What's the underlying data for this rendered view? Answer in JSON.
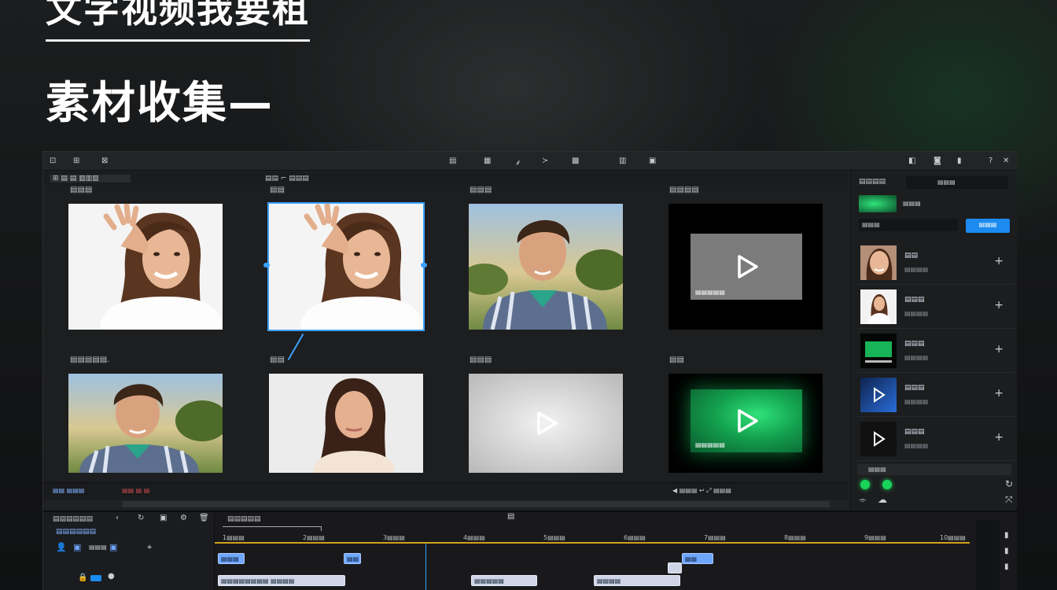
{
  "slide": {
    "title": "文字视频我要租",
    "subtitle": "素材收集—"
  },
  "colors": {
    "accent": "#3aa0ff",
    "green": "#18b45a",
    "clip_blue": "#6fa7ff"
  },
  "menubar": {
    "left_items": [
      "⊡",
      "⊞",
      "⊠"
    ],
    "center_items": [
      "▤",
      "▦",
      "⸙",
      "≻",
      "▩",
      "▥",
      "▣"
    ],
    "right_items": [
      "◧",
      "◙",
      "▮",
      "?",
      "✕"
    ]
  },
  "subbar": {
    "crumb_left": "⊞ ▤  ▤ ▥▥▥",
    "crumb_mid": "▤▤  ⌐ ▤▤▤"
  },
  "media": {
    "items": [
      {
        "label": "▤▤▤",
        "kind": "photo-woman-wave"
      },
      {
        "label": "▤▤",
        "kind": "photo-woman-wave-selected"
      },
      {
        "label": "▤▤▤",
        "kind": "photo-man"
      },
      {
        "label": "▤▤▤▤",
        "kind": "video-gray",
        "caption": "▤▤▤▤▤"
      },
      {
        "label": "▤▤▤▤▤.",
        "kind": "photo-man"
      },
      {
        "label": "▤▤",
        "kind": "photo-woman"
      },
      {
        "label": "▤▤▤",
        "kind": "video-white"
      },
      {
        "label": "▤▤",
        "kind": "video-green",
        "caption": "▤▤▤▤▤"
      }
    ]
  },
  "rightpanel": {
    "title": "▤▤▤▤",
    "tab": "▤▤▤",
    "preview_label": "▤▤▤",
    "search_placeholder": "▤▤▤",
    "apply_button": "▤▤▤",
    "list": [
      {
        "name": "▤▤",
        "sub": "▤▤▤▤",
        "kind": "face"
      },
      {
        "name": "▤▤▤",
        "sub": "▤▤▤▤",
        "kind": "woman"
      },
      {
        "name": "▤▤▤",
        "sub": "▤▤▤▤",
        "kind": "green"
      },
      {
        "name": "▤▤▤",
        "sub": "▤▤▤▤",
        "kind": "blue"
      },
      {
        "name": "▤▤▤",
        "sub": "▤▤▤▤",
        "kind": "dark"
      }
    ],
    "bottom_label": "▤▤▤"
  },
  "statusbar": {
    "left": "▤▤  ▤▤▤",
    "mid": "▤▤ ▤ ▤",
    "right": "◀ ▤▤▤   ↩   ⤢ ▤▤▤"
  },
  "timeline": {
    "header_title": "▤▤▤▤▤▤",
    "track_label": "▤▤▤▤▤▤",
    "tool_row": "▤▤▤",
    "center_title": "▤▤▤▤▤",
    "ticks": [
      "1▤▤▤",
      "2▤▤▤",
      "3▤▤▤",
      "4▤▤▤",
      "5▤▤▤",
      "6▤▤▤",
      "7▤▤▤",
      "8▤▤▤",
      "9▤▤▤",
      "10▤▤▤"
    ],
    "clips": [
      {
        "label": "▤▤▤",
        "color": "blue"
      },
      {
        "label": "▤▤",
        "color": "blue"
      },
      {
        "label": "▤▤",
        "color": "blue"
      },
      {
        "label": "▤▤▤▤▤▤▤▤ ▤▤▤▤",
        "color": "lb"
      },
      {
        "label": "▤▤▤▤▤",
        "color": "lb"
      },
      {
        "label": "▤▤▤▤",
        "color": "lb"
      },
      {
        "label": "",
        "color": "lb"
      }
    ]
  }
}
